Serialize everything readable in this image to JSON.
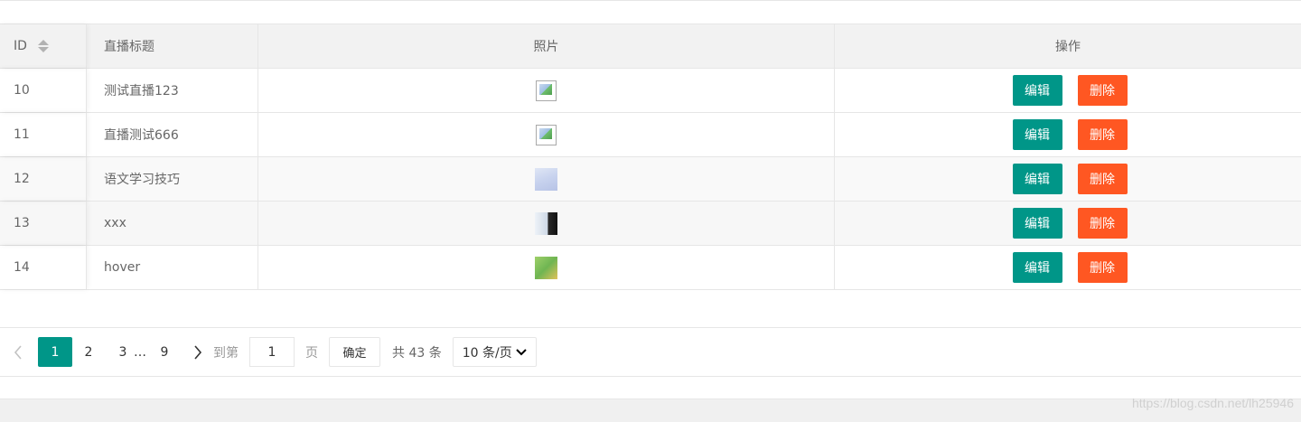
{
  "table": {
    "headers": {
      "id": "ID",
      "title": "直播标题",
      "photo": "照片",
      "operation": "操作"
    },
    "rows": [
      {
        "id": "10",
        "title": "测试直播123",
        "photo": "broken-image-icon"
      },
      {
        "id": "11",
        "title": "直播测试666",
        "photo": "broken-image-icon"
      },
      {
        "id": "12",
        "title": "语文学习技巧",
        "photo": "thumbnail-image"
      },
      {
        "id": "13",
        "title": "xxx",
        "photo": "thumbnail-image"
      },
      {
        "id": "14",
        "title": "hover",
        "photo": "thumbnail-image"
      }
    ],
    "edit_label": "编辑",
    "delete_label": "删除",
    "colors": {
      "edit": "#009688",
      "delete": "#ff5722"
    }
  },
  "pager": {
    "prev_icon": "chevron-left-icon",
    "current": "1",
    "pages": [
      "2",
      "3"
    ],
    "ellipsis": "…",
    "last": "9",
    "next_icon": "chevron-right-icon",
    "goto_label": "到第",
    "goto_value": "1",
    "page_unit": "页",
    "confirm_label": "确定",
    "total_label": "共 43 条",
    "page_size": "10 条/页",
    "accent": "#009688"
  },
  "watermark": "https://blog.csdn.net/lh25946"
}
